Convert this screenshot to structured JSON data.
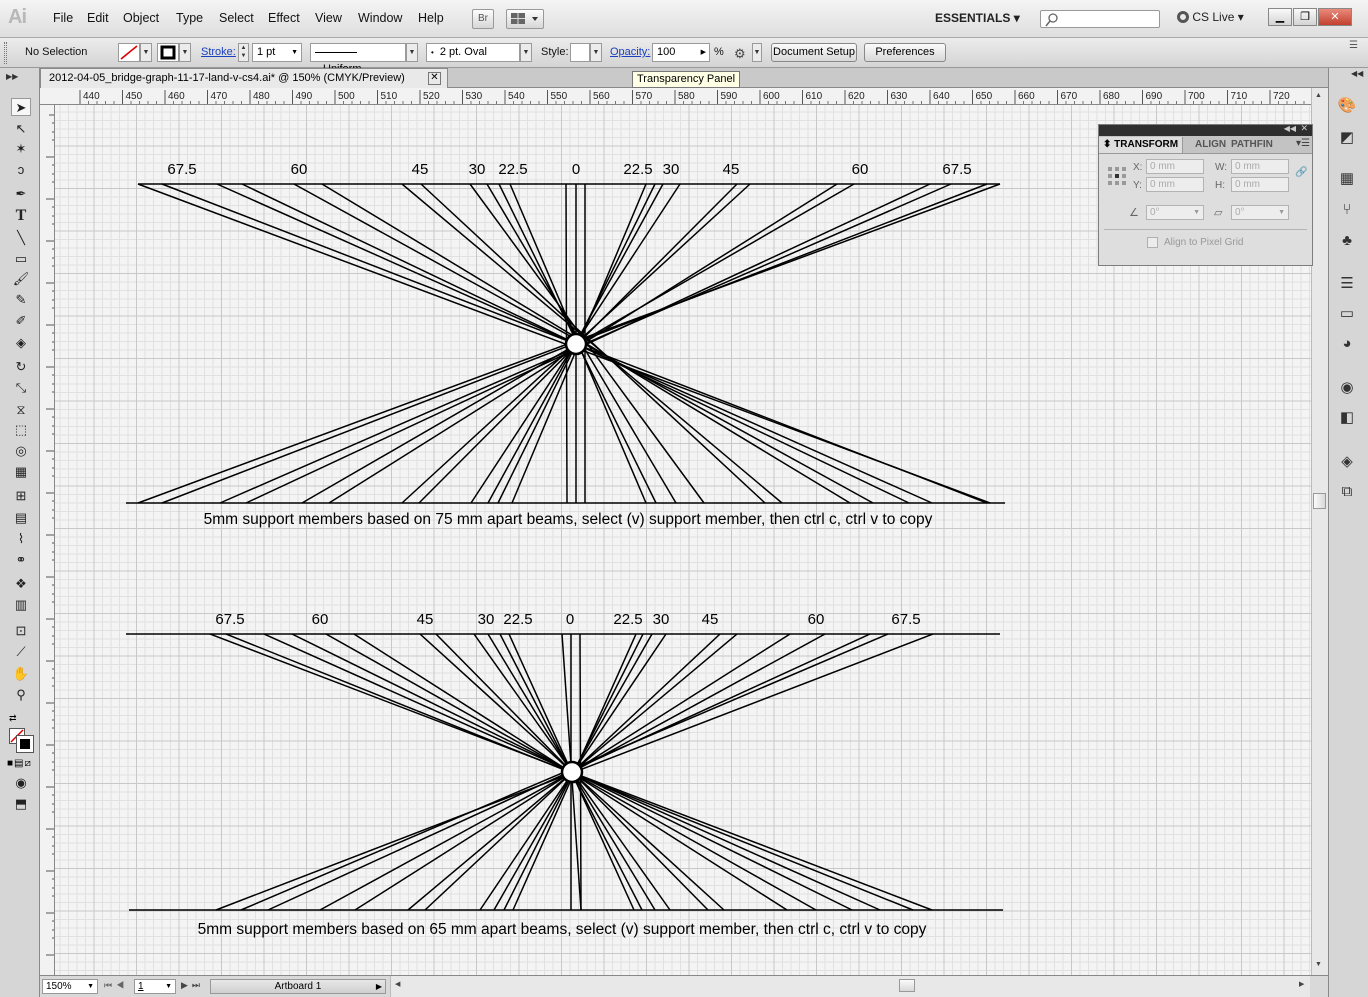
{
  "app": {
    "logo": "Ai"
  },
  "menu": [
    "File",
    "Edit",
    "Object",
    "Type",
    "Select",
    "Effect",
    "View",
    "Window",
    "Help"
  ],
  "menu_underline": [
    "F",
    "E",
    "O",
    "T",
    "S",
    "c",
    "V",
    "W",
    "H"
  ],
  "titlebar": {
    "bridge_label": "Br",
    "workspace": "ESSENTIALS",
    "cslive": "CS Live"
  },
  "controlbar": {
    "selection": "No Selection",
    "stroke_label": "Stroke:",
    "stroke_weight": "1 pt",
    "profile": "Uniform",
    "brush": "2 pt. Oval",
    "style_label": "Style:",
    "opacity_label": "Opacity:",
    "opacity_value": "100",
    "opacity_unit": "%",
    "doc_setup": "Document Setup",
    "preferences": "Preferences"
  },
  "tooltip": "Transparency Panel",
  "document": {
    "tab_title": "2012-04-05_bridge-graph-11-17-land-v-cs4.ai* @ 150% (CMYK/Preview)"
  },
  "ruler": {
    "h_ticks": [
      "440",
      "450",
      "460",
      "470",
      "480",
      "490",
      "500",
      "510",
      "520",
      "530",
      "540",
      "550",
      "560",
      "570",
      "580",
      "590",
      "600",
      "610",
      "620",
      "630",
      "640",
      "650",
      "660",
      "670",
      "680",
      "690",
      "700",
      "710",
      "720"
    ]
  },
  "transform_panel": {
    "tabs": [
      "TRANSFORM",
      "ALIGN",
      "PATHFIN"
    ],
    "x_label": "X:",
    "y_label": "Y:",
    "w_label": "W:",
    "h_label": "H:",
    "x": "0 mm",
    "y": "0 mm",
    "w": "0 mm",
    "h": "0 mm",
    "rotate": "0°",
    "shear": "0°",
    "align_pixel": "Align to Pixel Grid"
  },
  "diagrams": [
    {
      "angle_labels": [
        "67.5",
        "60",
        "45",
        "30",
        "22.5",
        "0",
        "22.5",
        "30",
        "45",
        "60",
        "67.5"
      ],
      "caption": "5mm support members based on 75 mm apart beams, select (v) support member, then ctrl c, ctrl v to copy"
    },
    {
      "angle_labels": [
        "67.5",
        "60",
        "45",
        "30",
        "22.5",
        "0",
        "22.5",
        "30",
        "45",
        "60",
        "67.5"
      ],
      "caption": "5mm support members based on 65 mm apart beams, select (v) support member, then ctrl c, ctrl v to copy"
    }
  ],
  "status": {
    "zoom": "150%",
    "page": "1",
    "artboard": "Artboard 1"
  }
}
